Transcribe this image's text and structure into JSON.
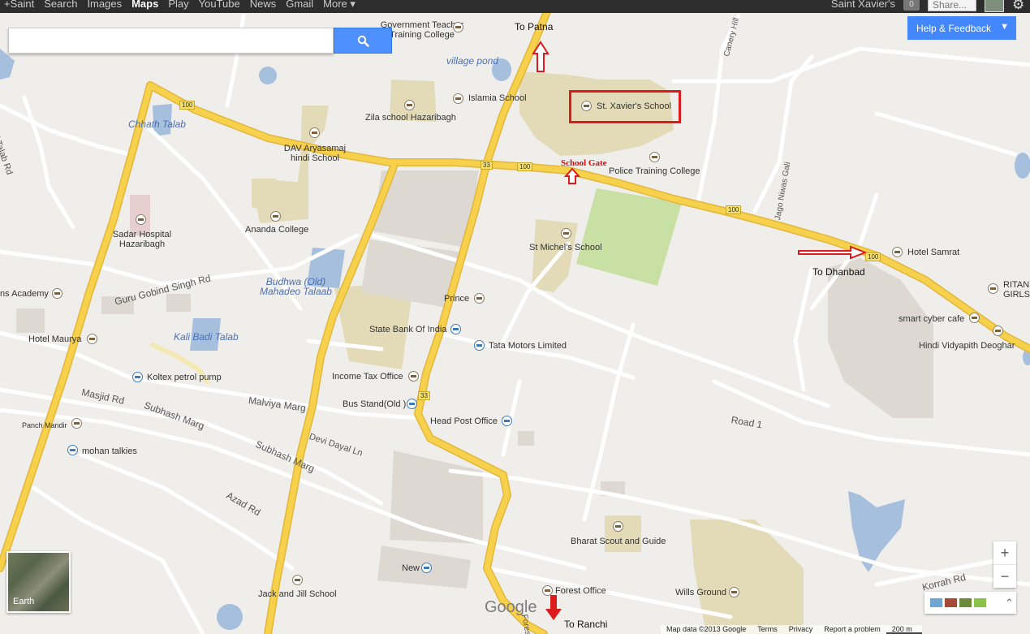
{
  "topbar": {
    "nav": [
      "+Saint",
      "Search",
      "Images",
      "Maps",
      "Play",
      "YouTube",
      "News",
      "Gmail",
      "More ▾"
    ],
    "active": "Maps",
    "user": "Saint Xavier's",
    "notifications": "0",
    "share": "Share..."
  },
  "search": {
    "value": "",
    "placeholder": ""
  },
  "help": {
    "label": "Help & Feedback"
  },
  "labels": {
    "govt_teacher_college": "Government Teacher\nTraining College",
    "village_pond": "village pond",
    "islamia_school": "Islamia School",
    "st_xaviers_school": "St. Xavier's School",
    "zila_school": "Zila school Hazaribagh",
    "chhath_talab": "Chhath Talab",
    "okni_talab_rd": "Okni Talab Rd",
    "dav_school": "DAV Aryasamaj\nhindi School",
    "police_training_college": "Police Training College",
    "jago_niwas_gali": "Jago Niwas Gali",
    "canery_hill": "Canery Hill",
    "sadar_hospital": "Sadar Hospital\nHazaribagh",
    "ananda_college": "Ananda College",
    "st_michels_school": "St Michel's School",
    "hotel_samrat": "Hotel Samrat",
    "ritan_girls": "RITAN\nGIRLS",
    "guru_gobind_singh_rd": "Guru Gobind Singh Rd",
    "budhwa_talaab": "Budhwa (Old)\nMahadeo Talaab",
    "prince": "Prince",
    "ns_academy": "ns Academy",
    "smart_cyber_cafe": "smart cyber cafe",
    "hindi_vidyapith": "Hindi Vidyapith Deoghar",
    "kali_badi_talab": "Kali Badi Talab",
    "hotel_maurya": "Hotel Maurya",
    "state_bank": "State Bank Of India",
    "tata_motors": "Tata Motors Limited",
    "koltex_petrol": "Koltex petrol pump",
    "income_tax": "Income Tax Office",
    "masjid_rd": "Masjid Rd",
    "malviya_marg": "Malviya Marg",
    "bus_stand": "Bus Stand(Old )",
    "subhash_marg_1": "Subhash Marg",
    "subhash_marg_2": "Subhash Marg",
    "panch_mandir": "Panch Mandir",
    "head_post_office": "Head Post Office",
    "devi_dayal_ln": "Devi Dayal Ln",
    "road_1": "Road 1",
    "mohan_talkies": "mohan talkies",
    "azad_rd": "Azad Rd",
    "bharat_scout": "Bharat Scout and Guide",
    "new": "New",
    "jack_and_jill": "Jack and Jill School",
    "forest_office": "Forest Office",
    "wills_ground": "Wills Ground",
    "korrah_rd": "Korrah Rd",
    "forest_rd": "Forest"
  },
  "shields": [
    "100",
    "33",
    "100",
    "100",
    "100",
    "33"
  ],
  "annotations": {
    "to_patna": "To Patna",
    "school_gate": "School Gate",
    "to_dhanbad": "To Dhanbad",
    "to_ranchi": "To Ranchi"
  },
  "earth": {
    "label": "Earth"
  },
  "zoom": {
    "in": "+",
    "out": "−"
  },
  "google": "Google",
  "footer": {
    "map_data": "Map data ©2013 Google",
    "terms": "Terms",
    "privacy": "Privacy",
    "report": "Report a problem",
    "scale": "200 m"
  },
  "colors": {
    "background": "#efeeea",
    "major_road": "#f7d14b",
    "water": "#a5bfdd",
    "campus": "#e3dbb8",
    "park": "#c9e0a4",
    "annotation": "#dc1c1c",
    "accent": "#4387fd"
  }
}
